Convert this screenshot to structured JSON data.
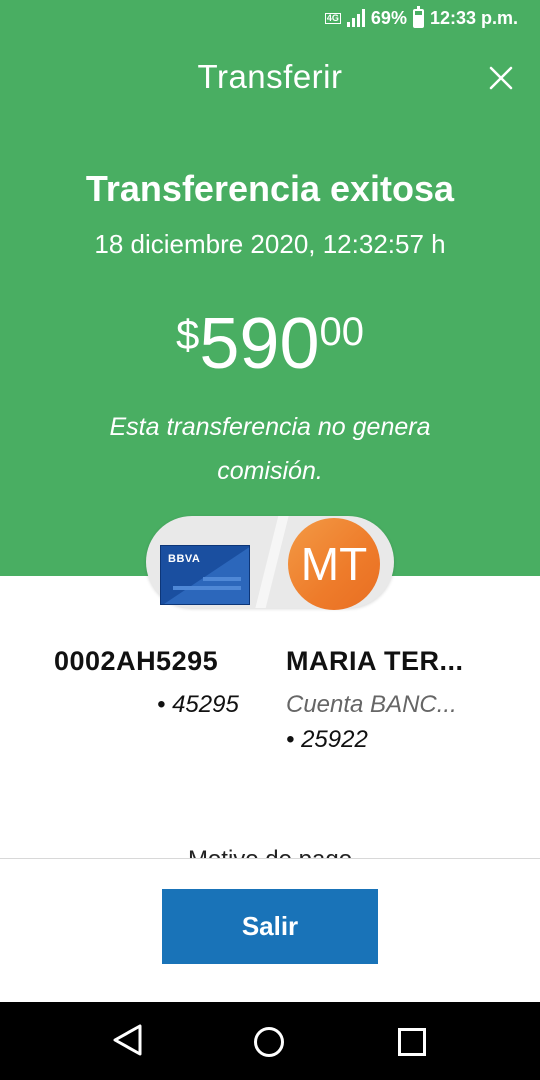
{
  "status_bar": {
    "network": "4G",
    "battery": "69%",
    "time": "12:33 p.m."
  },
  "header": {
    "title": "Transferir"
  },
  "result": {
    "heading": "Transferencia exitosa",
    "datetime": "18 diciembre 2020, 12:32:57 h",
    "amount": {
      "currency": "$",
      "integer": "590",
      "decimals": "00"
    },
    "note": "Esta transferencia no genera comisión."
  },
  "source": {
    "card_brand": "BBVA",
    "name": "0002AH5295",
    "account": "• 45295"
  },
  "destination": {
    "initials": "MT",
    "name": "MARIA TER...",
    "account_type": "Cuenta BANC...",
    "account": "• 25922"
  },
  "details": {
    "payment_reason_label": "Motivo de pago"
  },
  "actions": {
    "exit_label": "Salir"
  },
  "colors": {
    "header_green": "#49ae62",
    "button_blue": "#1973b8",
    "avatar_orange": "#ee7b2a",
    "card_blue": "#1a4fa0"
  }
}
